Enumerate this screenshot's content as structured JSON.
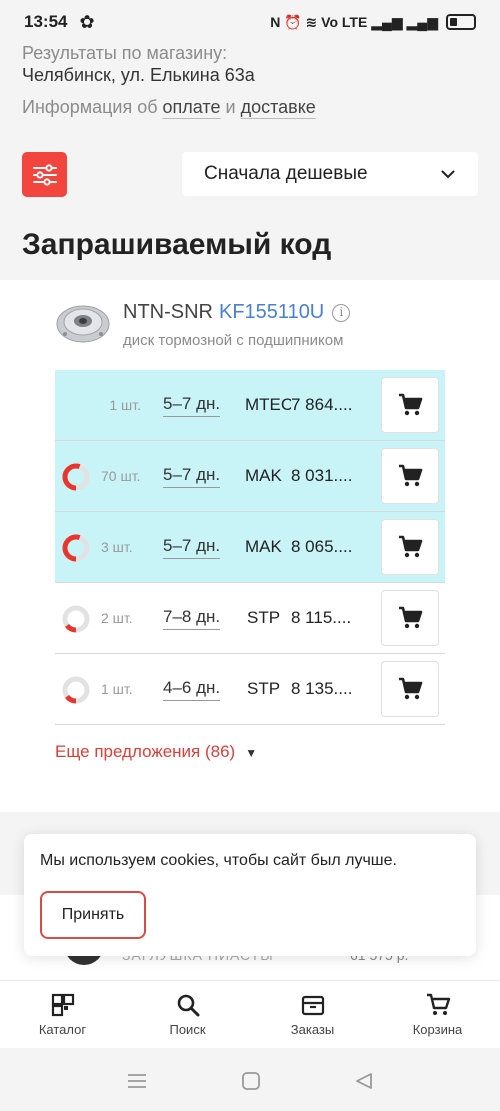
{
  "status": {
    "time": "13:54",
    "indicators": "N ⏰ ≋ Vo LTE ▂▄▆ ▂▄▆"
  },
  "store": {
    "results_label": "Результаты по магазину:",
    "address": "Челябинск, ул. Елькина 63а",
    "info_prefix": "Информация об",
    "payment_link": "оплате",
    "and": "и",
    "delivery_link": "доставке"
  },
  "sort": {
    "selected": "Сначала дешевые"
  },
  "section_title": "Запрашиваемый код",
  "product": {
    "brand": "NTN-SNR",
    "code": "KF155110U",
    "description": "диск тормозной с подшипником",
    "offers": [
      {
        "qty": "1 шт.",
        "days": "5–7 дн.",
        "supplier": "MTEC",
        "price": "7 864....",
        "highlight": true,
        "ring_fill": 0
      },
      {
        "qty": "70 шт.",
        "days": "5–7 дн.",
        "supplier": "MAK",
        "price": "8 031....",
        "highlight": true,
        "ring_fill": 0.55
      },
      {
        "qty": "3 шт.",
        "days": "5–7 дн.",
        "supplier": "MAK",
        "price": "8 065....",
        "highlight": true,
        "ring_fill": 0.55
      },
      {
        "qty": "2 шт.",
        "days": "7–8 дн.",
        "supplier": "STP",
        "price": "8 115....",
        "highlight": false,
        "ring_fill": 0.15
      },
      {
        "qty": "1 шт.",
        "days": "4–6 дн.",
        "supplier": "STP",
        "price": "8 135....",
        "highlight": false,
        "ring_fill": 0.15
      }
    ],
    "more_offers": "Еще предложения (86)"
  },
  "peek": {
    "name": "ЗАГЛУШКА ПИАСТЫ",
    "price": "61 575 р."
  },
  "cookie": {
    "text": "Мы используем cookies, чтобы сайт был лучше.",
    "accept": "Принять"
  },
  "nav": {
    "catalog": "Каталог",
    "search": "Поиск",
    "orders": "Заказы",
    "cart": "Корзина"
  },
  "colors": {
    "accent": "#f2453d",
    "link": "#4a7fd2",
    "highlight": "#c8f4f8"
  }
}
